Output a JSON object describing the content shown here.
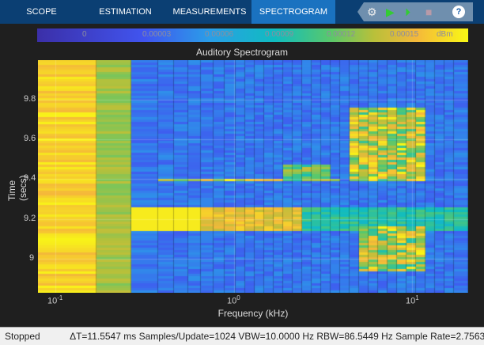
{
  "tabs": [
    "SCOPE",
    "ESTIMATION",
    "MEASUREMENTS",
    "SPECTROGRAM"
  ],
  "toolbar": {
    "settings": "⚙",
    "run": "▶",
    "step": "⏵",
    "stop": "■",
    "help": "?"
  },
  "colorbar": {
    "ticks": [
      "0",
      "0.00003",
      "0.00006",
      "0.00009",
      "0.00012",
      "0.00015"
    ],
    "unit": "dBm"
  },
  "plot": {
    "title": "Auditory Spectrogram",
    "xlabel": "Frequency (kHz)",
    "ylabel": "Time (secs)",
    "xticks": [
      "10",
      "10",
      "10"
    ],
    "xexp": [
      "-1",
      "0",
      "1"
    ],
    "yticks": [
      "9.8",
      "9.6",
      "9.4",
      "9.2",
      "9"
    ]
  },
  "status": {
    "state": "Stopped",
    "info": "ΔT=11.5547 ms  Samples/Update=1024  VBW=10.0000 Hz  RBW=86.5449 Hz  Sample Rate=2.7563"
  }
}
